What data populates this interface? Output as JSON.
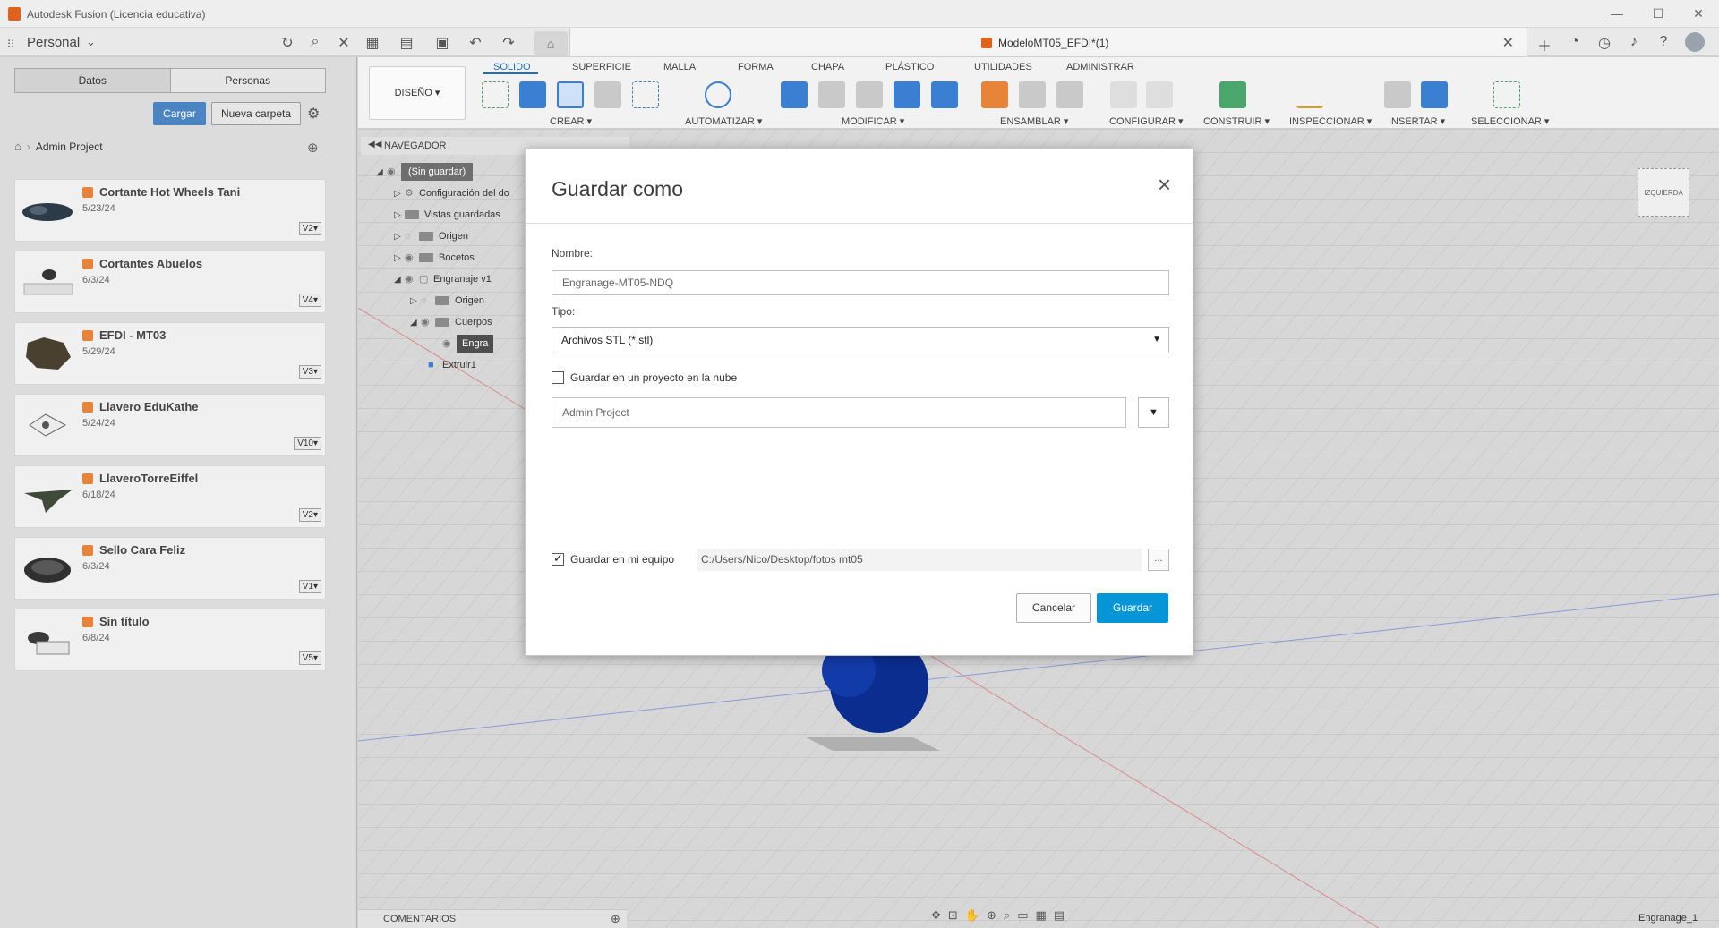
{
  "window": {
    "title": "Autodesk Fusion (Licencia educativa)",
    "minimize": "—",
    "maximize": "☐",
    "close": "✕"
  },
  "appbar": {
    "workspace": "Personal",
    "document_title": "ModeloMT05_EFDI*(1)"
  },
  "left_panel": {
    "tabs": [
      "Datos",
      "Personas"
    ],
    "upload_label": "Cargar",
    "new_folder_label": "Nueva carpeta",
    "breadcrumb": "Admin Project",
    "files": [
      {
        "name": "Cortante Hot Wheels Tani",
        "date": "5/23/24",
        "version": "V2▾"
      },
      {
        "name": "Cortantes Abuelos",
        "date": "6/3/24",
        "version": "V4▾"
      },
      {
        "name": "EFDI - MT03",
        "date": "5/29/24",
        "version": "V3▾"
      },
      {
        "name": "Llavero EduKathe",
        "date": "5/24/24",
        "version": "V10▾"
      },
      {
        "name": "LlaveroTorreEiffel",
        "date": "6/18/24",
        "version": "V2▾"
      },
      {
        "name": "Sello Cara Feliz",
        "date": "6/3/24",
        "version": "V1▾"
      },
      {
        "name": "Sin título",
        "date": "6/8/24",
        "version": "V5▾"
      }
    ]
  },
  "toolbar": {
    "design": "DISEÑO ▾",
    "tabs": [
      "SOLIDO",
      "SUPERFICIE",
      "MALLA",
      "FORMA",
      "CHAPA",
      "PLÁSTICO",
      "UTILIDADES",
      "ADMINISTRAR"
    ],
    "groups": [
      "CREAR ▾",
      "AUTOMATIZAR ▾",
      "MODIFICAR ▾",
      "ENSAMBLAR ▾",
      "CONFIGURAR ▾",
      "CONSTRUIR ▾",
      "INSPECCIONAR ▾",
      "INSERTAR ▾",
      "SELECCIONAR ▾"
    ]
  },
  "navigator": {
    "title": "NAVEGADOR",
    "root": "(Sin guardar)",
    "items": [
      "Configuración del do",
      "Vistas guardadas",
      "Origen",
      "Bocetos",
      "Engranaje v1",
      "Origen",
      "Cuerpos",
      "Engra",
      "Extruir1"
    ]
  },
  "viewcube": {
    "label": "IZQUIERDA"
  },
  "comments": {
    "label": "COMENTARIOS"
  },
  "status": {
    "component": "Engranage_1"
  },
  "dialog": {
    "title": "Guardar como",
    "name_label": "Nombre:",
    "name_placeholder": "Engranage-MT05-NDQ",
    "type_label": "Tipo:",
    "type_value": "Archivos STL (*.stl)",
    "cloud_label": "Guardar en un proyecto en la nube",
    "cloud_checked": false,
    "project_placeholder": "Admin Project",
    "local_label": "Guardar en mi equipo",
    "local_checked": true,
    "path_value": "C:/Users/Nico/Desktop/fotos mt05",
    "browse_label": "...",
    "cancel_label": "Cancelar",
    "save_label": "Guardar"
  },
  "colors": {
    "accent": "#0696d7",
    "upload": "#4b84c2",
    "tab_active": "#1d6fb8",
    "brand_orange": "#e0621c"
  }
}
